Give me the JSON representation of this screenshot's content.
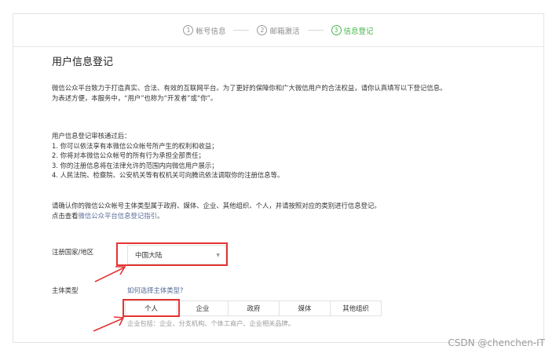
{
  "steps": [
    {
      "num": "1",
      "label": "帐号信息"
    },
    {
      "num": "2",
      "label": "邮箱激活"
    },
    {
      "num": "3",
      "label": "信息登记"
    }
  ],
  "page": {
    "title": "用户信息登记",
    "intro": [
      "微信公众平台致力于打造真实、合法、有效的互联网平台。为了更好的保障你和广大微信用户的合法权益，请你认真填写以下登记信息。",
      "为表述方便，本服务中，“用户”也称为“开发者”或“你”。"
    ],
    "review": [
      "用户信息登记审核通过后：",
      "1. 你可以依法享有本微信公众帐号所产生的权利和收益；",
      "2. 你将对本微信公众帐号的所有行为承担全部责任；",
      "3. 你的注册信息将在法律允许的范围内向微信用户展示；",
      "4. 人民法院、检察院、公安机关等有权机关可向腾讯依法调取你的注册信息等。"
    ],
    "confirm": "请确认你的微信公众帐号主体类型属于政府、媒体、企业、其他组织、个人，并请按照对应的类别进行信息登记。",
    "guide_prefix": "点击查看",
    "guide_link": "微信公众平台信息登记指引",
    "guide_suffix": "。"
  },
  "form": {
    "country_label": "注册国家/地区",
    "country_value": "中国大陆",
    "type_label": "主体类型",
    "type_help_link": "如何选择主体类型?",
    "type_tabs": [
      "个人",
      "企业",
      "政府",
      "媒体",
      "其他组织"
    ],
    "active_tab_index": 0,
    "hint": "企业包括：企业、分支机构、个体工商户、企业相关品牌。"
  },
  "watermark": "CSDN @chenchen-IT",
  "colors": {
    "accent_green": "#44b549",
    "link_blue": "#576b95",
    "annotation_red": "#e43333"
  }
}
